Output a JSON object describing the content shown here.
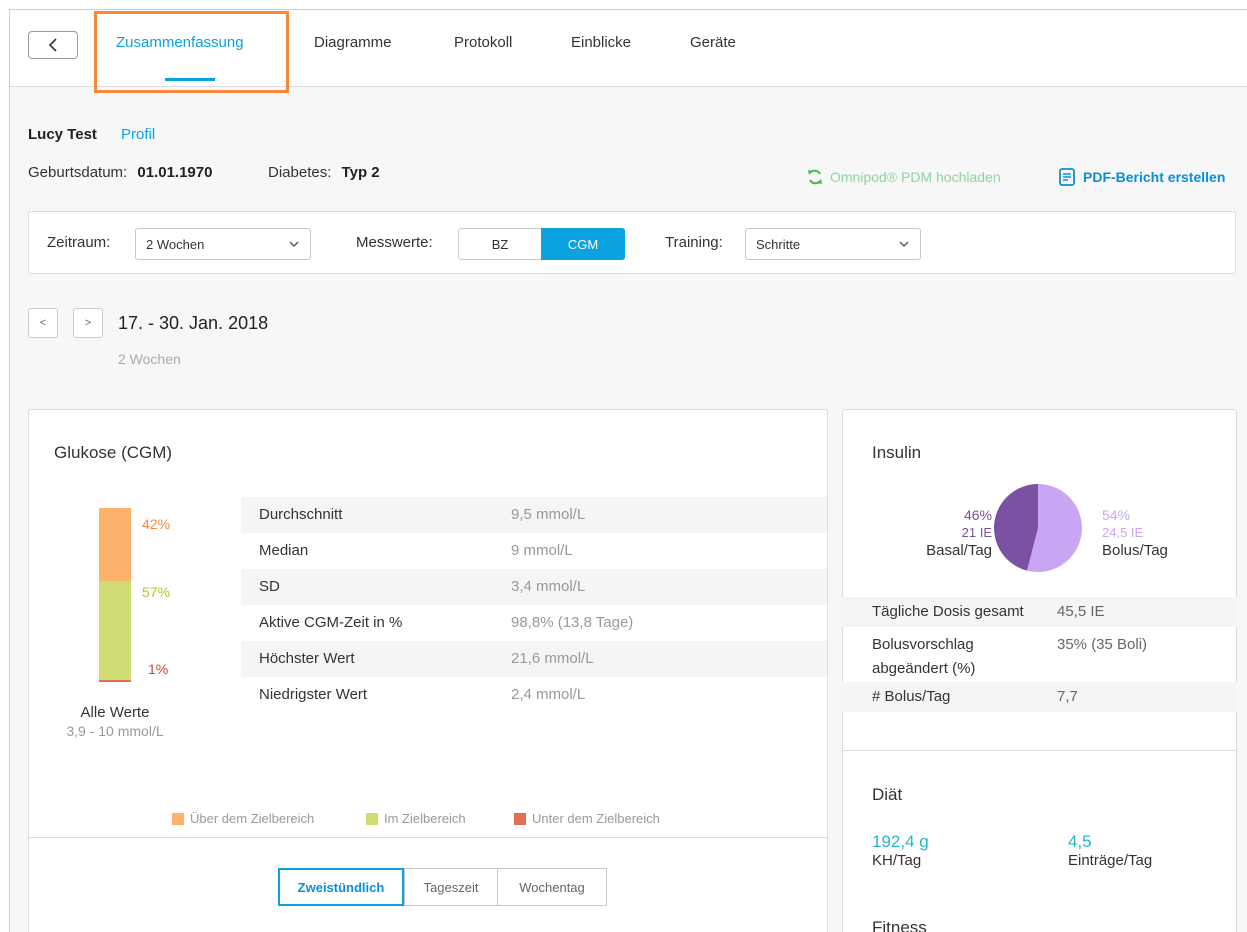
{
  "tabs": [
    {
      "label": "Zusammenfassung",
      "active": true
    },
    {
      "label": "Diagramme",
      "active": false
    },
    {
      "label": "Protokoll",
      "active": false
    },
    {
      "label": "Einblicke",
      "active": false
    },
    {
      "label": "Geräte",
      "active": false
    }
  ],
  "patient": {
    "name": "Lucy Test",
    "profile_link": "Profil",
    "birthdate_label": "Geburtsdatum:",
    "birthdate": "01.01.1970",
    "diabetes_label": "Diabetes:",
    "diabetes_type": "Typ 2"
  },
  "actions": {
    "upload": "Omnipod® PDM hochladen",
    "pdf": "PDF-Bericht erstellen"
  },
  "filters": {
    "period_label": "Zeitraum:",
    "period_value": "2 Wochen",
    "measure_label": "Messwerte:",
    "measure_options": [
      "BZ",
      "CGM"
    ],
    "measure_active": "CGM",
    "training_label": "Training:",
    "training_value": "Schritte"
  },
  "date_nav": {
    "prev": "<",
    "next": ">",
    "range": "17. - 30. Jan. 2018",
    "sub": "2 Wochen"
  },
  "glucose": {
    "title": "Glukose (CGM)",
    "above_pct": "42%",
    "in_pct": "57%",
    "below_pct": "1%",
    "above_fraction": 0.42,
    "in_fraction": 0.57,
    "below_fraction": 0.01,
    "all_values_label": "Alle Werte",
    "range_label": "3,9 - 10 mmol/L",
    "stats": [
      {
        "label": "Durchschnitt",
        "value": "9,5 mmol/L"
      },
      {
        "label": "Median",
        "value": "9 mmol/L"
      },
      {
        "label": "SD",
        "value": "3,4 mmol/L"
      },
      {
        "label": "Aktive CGM-Zeit in %",
        "value": "98,8% (13,8 Tage)"
      },
      {
        "label": "Höchster Wert",
        "value": "21,6 mmol/L"
      },
      {
        "label": "Niedrigster Wert",
        "value": "2,4 mmol/L"
      }
    ],
    "legend": [
      "Über dem Zielbereich",
      "Im Zielbereich",
      "Unter dem Zielbereich"
    ],
    "grouping": [
      "Zweistündlich",
      "Tageszeit",
      "Wochentag"
    ],
    "grouping_active": "Zweistündlich"
  },
  "insulin": {
    "title": "Insulin",
    "basal_pct": "46%",
    "basal_units": "21 IE",
    "basal_label": "Basal/Tag",
    "bolus_pct": "54%",
    "bolus_units": "24,5 IE",
    "bolus_label": "Bolus/Tag",
    "basal_fraction": 0.46,
    "rows": [
      {
        "label": "Tägliche Dosis gesamt",
        "value": "45,5 IE"
      },
      {
        "label": "Bolusvorschlag abgeändert (%)",
        "value": "35% (35 Boli)"
      },
      {
        "label": "# Bolus/Tag",
        "value": "7,7"
      }
    ]
  },
  "diet": {
    "title": "Diät",
    "carbs_value": "192,4 g",
    "carbs_label": "KH/Tag",
    "entries_value": "4,5",
    "entries_label": "Einträge/Tag"
  },
  "fitness": {
    "title": "Fitness"
  },
  "colors": {
    "accent": "#0aa3e0",
    "above": "#fbb36b",
    "in_range": "#cfdb73",
    "below": "#e46d4f",
    "basal": "#7b52a3",
    "bolus": "#c9a6f3",
    "diet": "#22b8c9",
    "highlight": "#f5883a"
  }
}
